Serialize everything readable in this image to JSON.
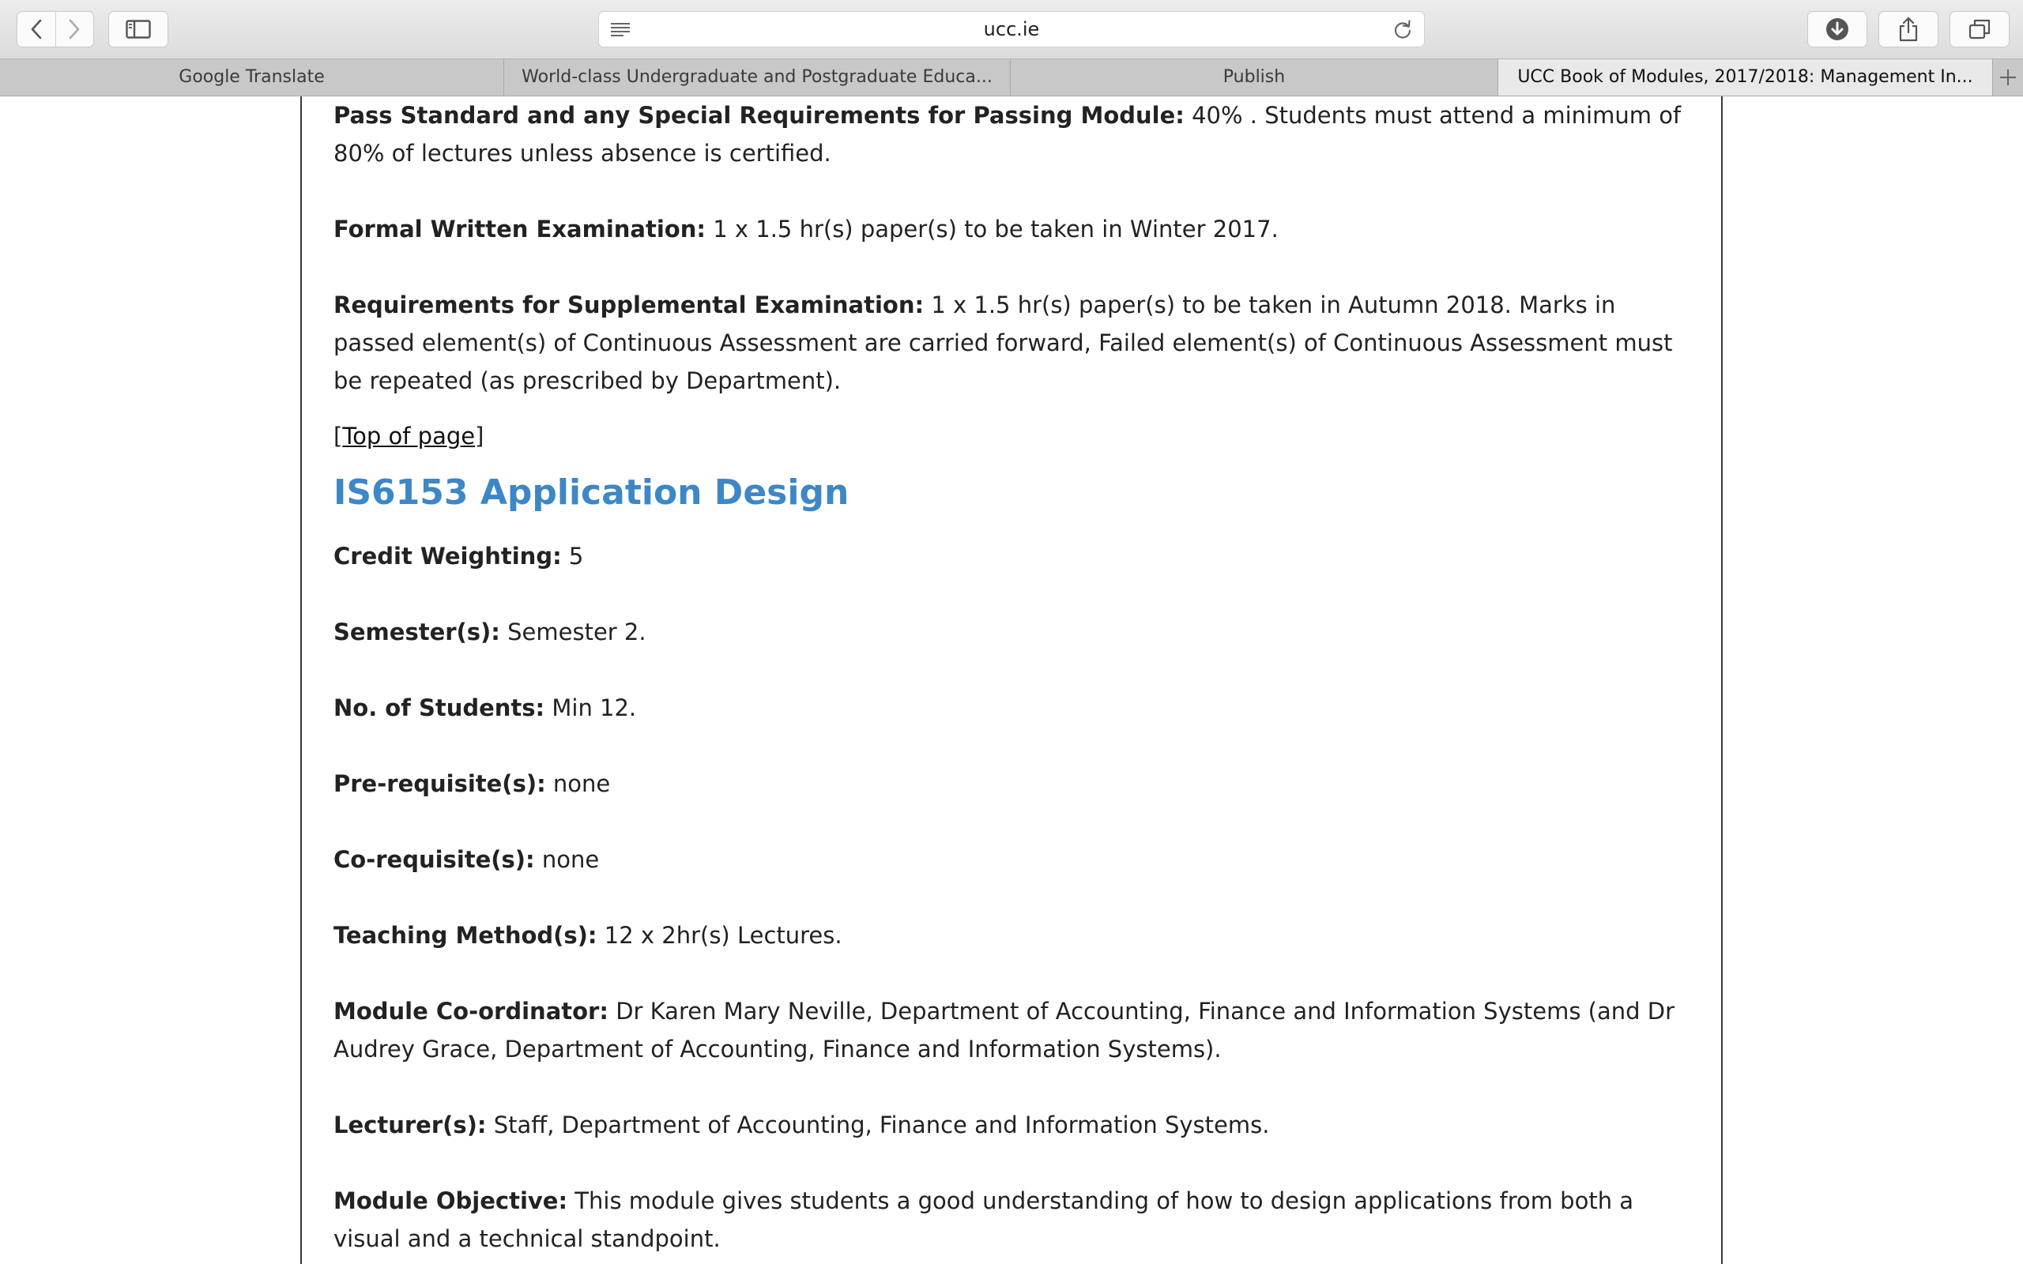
{
  "browser": {
    "url": "ucc.ie",
    "tabs": [
      {
        "label": "Google Translate"
      },
      {
        "label": "World-class Undergraduate and Postgraduate Educa..."
      },
      {
        "label": "Publish"
      },
      {
        "label": "UCC Book of Modules, 2017/2018: Management In..."
      }
    ],
    "active_tab": 3
  },
  "page": {
    "prev_module": {
      "pass_standard": {
        "label": "Pass Standard and any Special Requirements for Passing Module:",
        "value": "40% . Students must attend a minimum of 80% of lectures unless absence is certified."
      },
      "formal_exam": {
        "label": "Formal Written Examination:",
        "value": "1 x 1.5 hr(s) paper(s) to be taken in Winter 2017."
      },
      "supplemental": {
        "label": "Requirements for Supplemental Examination:",
        "value": "1 x 1.5 hr(s) paper(s) to be taken in Autumn 2018. Marks in passed element(s) of Continuous Assessment are carried forward, Failed element(s) of Continuous Assessment must be repeated (as prescribed by Department)."
      }
    },
    "top_link": {
      "open": "[",
      "label": "Top of page",
      "close": "]"
    },
    "module": {
      "title": "IS6153 Application Design",
      "credit": {
        "label": "Credit Weighting:",
        "value": "5"
      },
      "semester": {
        "label": "Semester(s):",
        "value": "Semester 2."
      },
      "students": {
        "label": "No. of Students:",
        "value": "Min 12."
      },
      "prereq": {
        "label": "Pre-requisite(s):",
        "value": "none"
      },
      "coreq": {
        "label": "Co-requisite(s):",
        "value": "none"
      },
      "teaching": {
        "label": "Teaching Method(s):",
        "value": "12 x 2hr(s) Lectures."
      },
      "coordinator": {
        "label": "Module Co-ordinator:",
        "value": "Dr Karen Mary Neville, Department of Accounting, Finance and Information Systems (and Dr Audrey Grace, Department of Accounting, Finance and Information Systems)."
      },
      "lecturers": {
        "label": "Lecturer(s):",
        "value": "Staff, Department of Accounting, Finance and Information Systems."
      },
      "objective": {
        "label": "Module Objective:",
        "value": "This module gives students a good understanding of how to design applications from both a visual and a technical standpoint."
      }
    }
  },
  "colors": {
    "module_title": "#3d87c6",
    "text": "#222222",
    "tabbar": "#c8c8c8",
    "active_tab": "#e9e9e9"
  },
  "icons": [
    "back-icon",
    "forward-icon",
    "sidebar-icon",
    "reader-icon",
    "reload-icon",
    "download-icon",
    "share-icon",
    "tabs-overview-icon",
    "add-tab-icon"
  ]
}
